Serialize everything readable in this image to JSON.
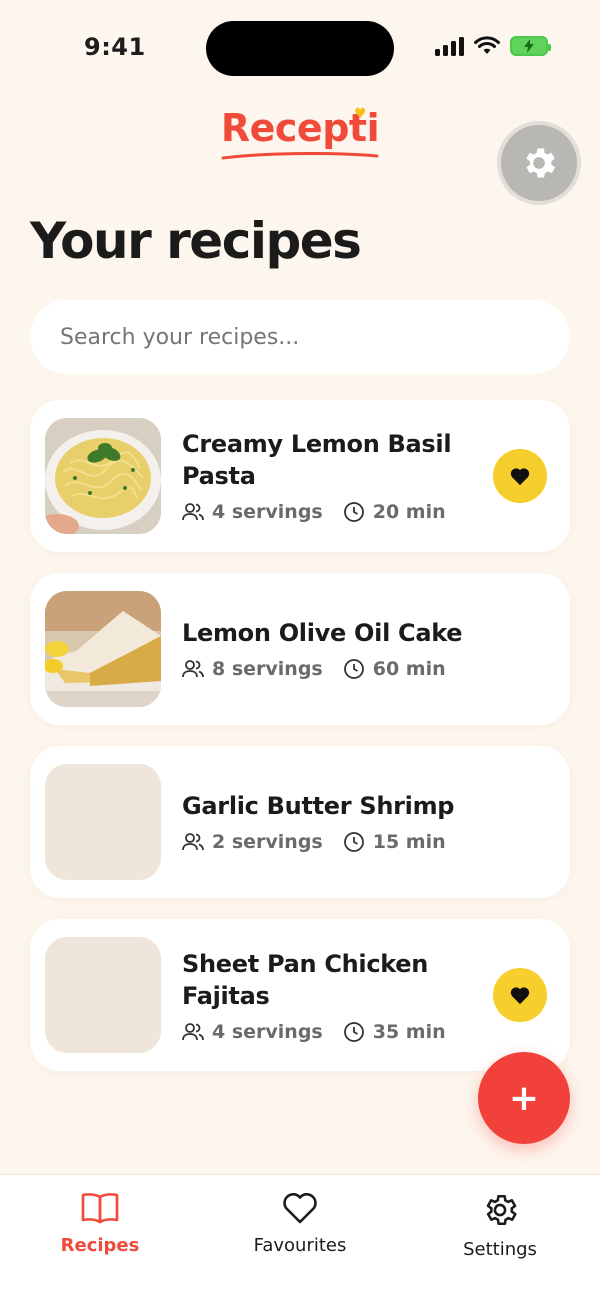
{
  "status": {
    "time": "9:41"
  },
  "app": {
    "logo": "Recepti"
  },
  "page": {
    "title": "Your recipes"
  },
  "search": {
    "placeholder": "Search your recipes..."
  },
  "recipes": [
    {
      "title": "Creamy Lemon Basil Pasta",
      "servings": "4 servings",
      "time": "20 min",
      "favourite": true,
      "image": "pasta"
    },
    {
      "title": "Lemon Olive Oil Cake",
      "servings": "8 servings",
      "time": "60 min",
      "favourite": false,
      "image": "cake"
    },
    {
      "title": "Garlic Butter Shrimp",
      "servings": "2 servings",
      "time": "15 min",
      "favourite": false,
      "image": "none"
    },
    {
      "title": "Sheet Pan Chicken Fajitas",
      "servings": "4 servings",
      "time": "35 min",
      "favourite": true,
      "image": "none"
    }
  ],
  "fab": {
    "label": "+"
  },
  "tabs": [
    {
      "label": "Recipes",
      "icon": "book-icon",
      "active": true
    },
    {
      "label": "Favourites",
      "icon": "heart-icon",
      "active": false
    },
    {
      "label": "Settings",
      "icon": "gear-icon",
      "active": false
    }
  ],
  "colors": {
    "accent": "#ef4a3a",
    "favourite": "#f7cf2c",
    "background": "#fdf6ee"
  }
}
